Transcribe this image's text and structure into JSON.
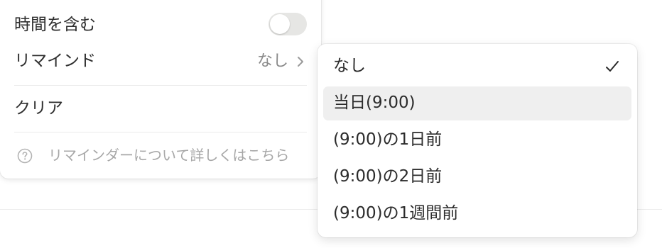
{
  "settings": {
    "include_time_label": "時間を含む",
    "include_time_on": false,
    "reminder_label": "リマインド",
    "reminder_value": "なし",
    "clear_label": "クリア",
    "help_text": "リマインダーについて詳しくはこちら"
  },
  "reminder_menu": {
    "selected_index": 0,
    "highlighted_index": 1,
    "items": [
      {
        "label": "なし"
      },
      {
        "label": "当日(9:00)"
      },
      {
        "label": "(9:00)の1日前"
      },
      {
        "label": "(9:00)の2日前"
      },
      {
        "label": "(9:00)の1週間前"
      }
    ]
  },
  "colors": {
    "toggle_off": "#e6e6e4",
    "highlight": "#efefef",
    "muted_text": "#8a8a8a",
    "help_text": "#a7a7a7"
  }
}
